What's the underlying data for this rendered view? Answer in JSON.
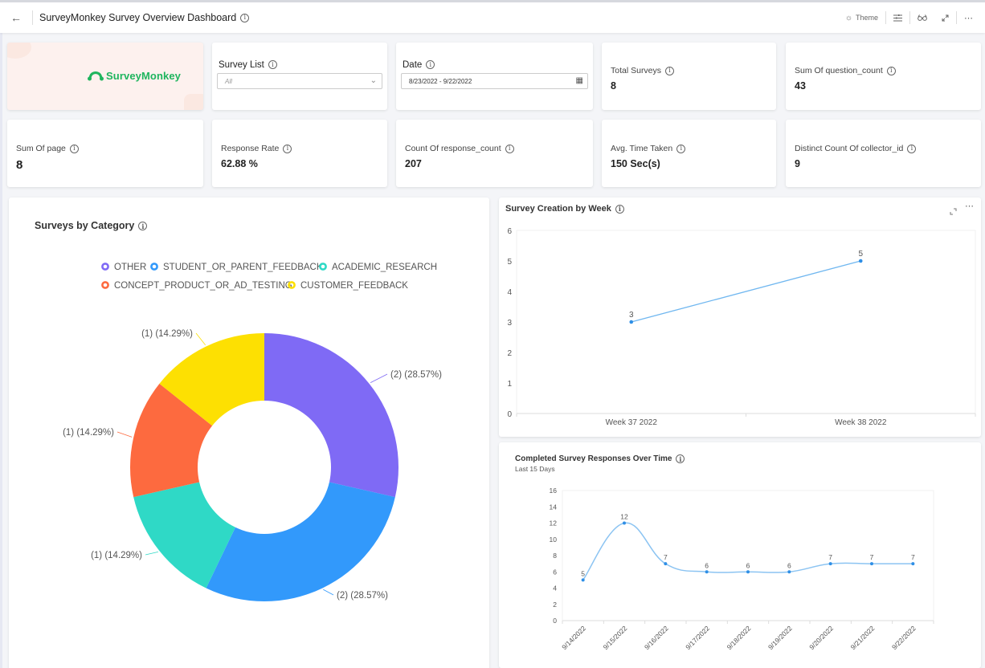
{
  "header": {
    "back_icon": "arrow-left-icon",
    "title": "SurveyMonkey Survey Overview Dashboard",
    "info_icon": "info-icon",
    "actions": [
      {
        "name": "theme",
        "label": "Theme",
        "icon": "sun-icon"
      },
      {
        "name": "filter",
        "label": "",
        "icon": "filter-sliders-icon"
      },
      {
        "name": "view",
        "label": "",
        "icon": "glasses-icon"
      },
      {
        "name": "fullscreen",
        "label": "",
        "icon": "expand-icon"
      },
      {
        "name": "more",
        "label": "",
        "icon": "more-horizontal-icon"
      }
    ]
  },
  "logo": {
    "text": "SurveyMonkey",
    "color": "#1fb55e"
  },
  "filters": {
    "survey_list": {
      "label": "Survey List",
      "value": "All"
    },
    "date": {
      "label": "Date",
      "value": "8/23/2022 - 9/22/2022"
    }
  },
  "kpis_row1": [
    {
      "label": "Total Surveys",
      "value": "8"
    },
    {
      "label": "Sum Of question_count",
      "value": "43"
    }
  ],
  "kpis_row2": [
    {
      "label": "Sum Of page",
      "value": "8"
    },
    {
      "label": "Response Rate",
      "value": "62.88 %"
    },
    {
      "label": "Count Of response_count",
      "value": "207"
    },
    {
      "label": "Avg. Time Taken",
      "value": "150 Sec(s)"
    },
    {
      "label": "Distinct Count Of collector_id",
      "value": "9"
    }
  ],
  "chart_data": [
    {
      "type": "pie",
      "title": "Surveys by Category",
      "donut": true,
      "legend_position": "top",
      "categories": [
        "OTHER",
        "STUDENT_OR_PARENT_FEEDBACK",
        "ACADEMIC_RESEARCH",
        "CONCEPT_PRODUCT_OR_AD_TESTING",
        "CUSTOMER_FEEDBACK"
      ],
      "values": [
        2,
        2,
        1,
        1,
        1
      ],
      "percentages": [
        28.57,
        28.57,
        14.29,
        14.29,
        14.29
      ],
      "data_labels": [
        "(2) (28.57%)",
        "(2) (28.57%)",
        "(1) (14.29%)",
        "(1) (14.29%)",
        "(1) (14.29%)"
      ],
      "colors": [
        "#7f6af5",
        "#3299fb",
        "#2fd9c6",
        "#fd6a3f",
        "#fde002"
      ]
    },
    {
      "type": "line",
      "title": "Survey Creation by Week",
      "categories": [
        "Week 37 2022",
        "Week 38 2022"
      ],
      "values": [
        3,
        5
      ],
      "data_labels": [
        "3",
        "5"
      ],
      "ylim": [
        0,
        6
      ],
      "yticks": [
        "0",
        "1",
        "2",
        "3",
        "4",
        "5",
        "6"
      ],
      "xlabel": "",
      "ylabel": "",
      "grid": false,
      "color": "#70b7f0"
    },
    {
      "type": "line",
      "title": "Completed Survey Responses Over Time",
      "subtitle": "Last 15 Days",
      "smooth": true,
      "categories": [
        "9/14/2022",
        "9/15/2022",
        "9/16/2022",
        "9/17/2022",
        "9/18/2022",
        "9/19/2022",
        "9/20/2022",
        "9/21/2022",
        "9/22/2022"
      ],
      "values": [
        5,
        12,
        7,
        6,
        6,
        6,
        7,
        7,
        7
      ],
      "data_labels": [
        "5",
        "12",
        "7",
        "6",
        "6",
        "6",
        "7",
        "7",
        "7"
      ],
      "ylim": [
        0,
        16
      ],
      "yticks": [
        "0",
        "2",
        "4",
        "6",
        "8",
        "10",
        "12",
        "14",
        "16"
      ],
      "xlabel": "",
      "ylabel": "",
      "grid": false,
      "color": "#8cc4f2"
    }
  ],
  "widget_actions": {
    "expand_icon": "expand-icon",
    "more_icon": "more-horizontal-icon"
  }
}
